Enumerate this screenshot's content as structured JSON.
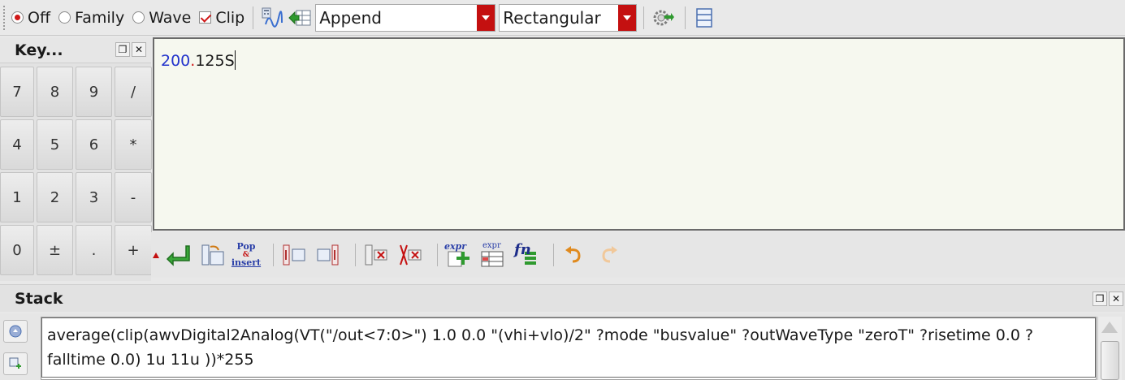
{
  "toolbar": {
    "radio_options": [
      {
        "label": "Off",
        "selected": true
      },
      {
        "label": "Family",
        "selected": false
      },
      {
        "label": "Wave",
        "selected": false
      }
    ],
    "clip": {
      "label": "Clip",
      "checked": true
    },
    "mode_select": {
      "value": "Append"
    },
    "shape_select": {
      "value": "Rectangular"
    },
    "icons": [
      "calculator-wave-icon",
      "send-to-table-icon",
      "settings-gear-icon",
      "stack-list-icon"
    ]
  },
  "keypad": {
    "title": "Key...",
    "keys": [
      "7",
      "8",
      "9",
      "/",
      "4",
      "5",
      "6",
      "*",
      "1",
      "2",
      "3",
      "-",
      "0",
      "±",
      ".",
      "+"
    ]
  },
  "editor": {
    "value_int": "200",
    "value_dot": ".",
    "value_frac": "125S"
  },
  "bottom_toolbar": {
    "pop_insert_label_1": "Pop",
    "pop_insert_label_2": "&",
    "pop_insert_label_3": "insert",
    "expr_label": "expr",
    "fn_label": "fn"
  },
  "stack": {
    "title": "Stack",
    "items": [
      {
        "text": "average(clip(awvDigital2Analog(VT(\"/out<7:0>\") 1.0 0.0 \"(vhi+vlo)/2\" ?mode \"busvalue\" ?outWaveType \"zeroT\" ?risetime 0.0 ?falltime 0.0) 1u 11u ))*255"
      }
    ]
  },
  "colors": {
    "accent_red": "#c41010",
    "number_blue": "#2233cc",
    "editor_bg": "#f6f8ef"
  }
}
